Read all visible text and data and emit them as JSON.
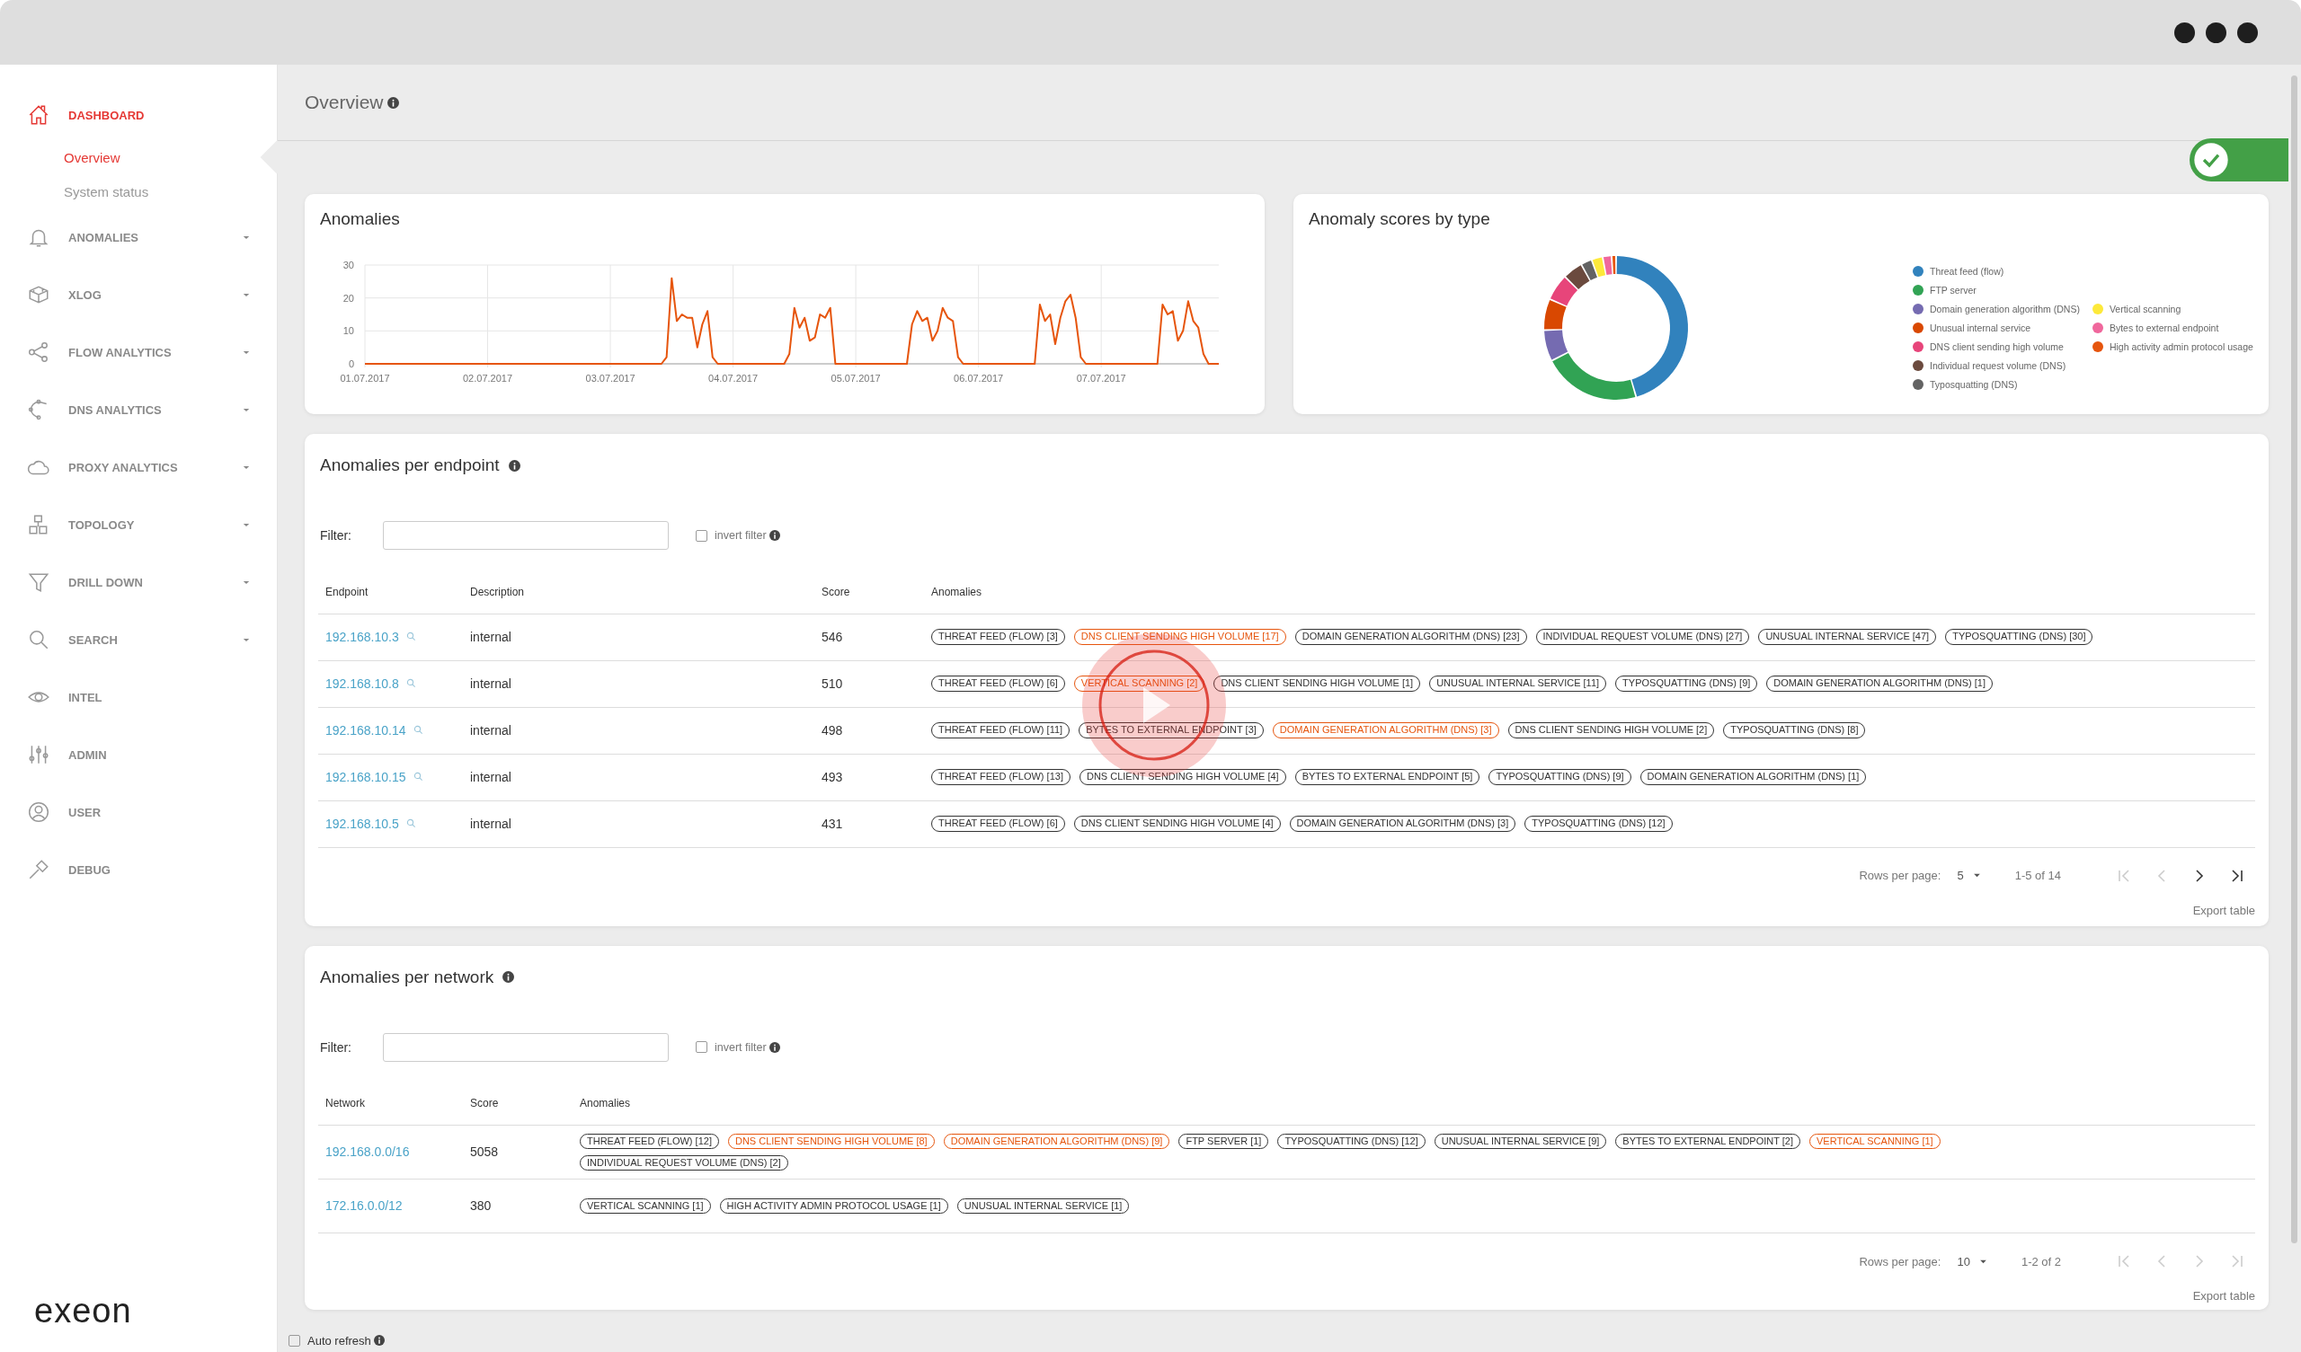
{
  "sidebar": {
    "items": [
      {
        "label": "DASHBOARD",
        "selected": true,
        "expandable": false,
        "children": [
          {
            "label": "Overview",
            "selected": true
          },
          {
            "label": "System status",
            "selected": false
          }
        ]
      },
      {
        "label": "ANOMALIES",
        "selected": false,
        "expandable": true
      },
      {
        "label": "XLOG",
        "selected": false,
        "expandable": true
      },
      {
        "label": "FLOW ANALYTICS",
        "selected": false,
        "expandable": true
      },
      {
        "label": "DNS ANALYTICS",
        "selected": false,
        "expandable": true
      },
      {
        "label": "PROXY ANALYTICS",
        "selected": false,
        "expandable": true
      },
      {
        "label": "TOPOLOGY",
        "selected": false,
        "expandable": true
      },
      {
        "label": "DRILL DOWN",
        "selected": false,
        "expandable": true
      },
      {
        "label": "SEARCH",
        "selected": false,
        "expandable": true
      },
      {
        "label": "INTEL",
        "selected": false,
        "expandable": false
      },
      {
        "label": "ADMIN",
        "selected": false,
        "expandable": false
      },
      {
        "label": "USER",
        "selected": false,
        "expandable": false
      },
      {
        "label": "DEBUG",
        "selected": false,
        "expandable": false
      }
    ]
  },
  "logo": "exeon",
  "page": {
    "title": "Overview"
  },
  "status_toggle": {
    "on": true
  },
  "anomalies_chart": {
    "title": "Anomalies",
    "chart_data": {
      "type": "line",
      "ylim": [
        0,
        30
      ],
      "yticks": [
        0,
        10,
        20,
        30
      ],
      "categories": [
        "01.07.2017",
        null,
        null,
        null,
        null,
        null,
        null,
        null,
        null,
        null,
        null,
        null,
        null,
        null,
        null,
        null,
        null,
        null,
        null,
        null,
        null,
        null,
        null,
        null,
        "02.07.2017",
        null,
        null,
        null,
        null,
        null,
        null,
        null,
        null,
        null,
        null,
        null,
        null,
        null,
        null,
        null,
        null,
        null,
        null,
        null,
        null,
        null,
        null,
        null,
        "03.07.2017",
        null,
        null,
        null,
        null,
        null,
        null,
        null,
        null,
        null,
        null,
        null,
        null,
        null,
        null,
        null,
        null,
        null,
        null,
        null,
        null,
        null,
        null,
        null,
        "04.07.2017",
        null,
        null,
        null,
        null,
        null,
        null,
        null,
        null,
        null,
        null,
        null,
        null,
        null,
        null,
        null,
        null,
        null,
        null,
        null,
        null,
        null,
        null,
        null,
        "05.07.2017",
        null,
        null,
        null,
        null,
        null,
        null,
        null,
        null,
        null,
        null,
        null,
        null,
        null,
        null,
        null,
        null,
        null,
        null,
        null,
        null,
        null,
        null,
        null,
        "06.07.2017",
        null,
        null,
        null,
        null,
        null,
        null,
        null,
        null,
        null,
        null,
        null,
        null,
        null,
        null,
        null,
        null,
        null,
        null,
        null,
        null,
        null,
        null,
        null,
        "07.07.2017",
        null,
        null,
        null,
        null,
        null,
        null,
        null,
        null,
        null,
        null,
        null,
        null,
        null,
        null,
        null,
        null,
        null,
        null,
        null,
        null,
        null,
        null,
        null
      ],
      "series": [
        {
          "color": "#e6550d",
          "values": [
            0,
            0,
            0,
            0,
            0,
            0,
            0,
            0,
            0,
            0,
            0,
            0,
            0,
            0,
            0,
            0,
            0,
            0,
            0,
            0,
            0,
            0,
            0,
            0,
            0,
            0,
            0,
            0,
            0,
            0,
            0,
            0,
            0,
            0,
            0,
            0,
            0,
            0,
            0,
            0,
            0,
            0,
            0,
            0,
            0,
            0,
            0,
            0,
            0,
            0,
            0,
            0,
            0,
            0,
            0,
            0,
            0,
            0,
            0,
            2,
            26,
            13,
            15,
            14,
            14,
            5,
            12,
            16,
            2,
            0,
            0,
            0,
            0,
            0,
            0,
            0,
            0,
            0,
            0,
            0,
            0,
            0,
            0,
            3,
            17,
            11,
            14,
            7,
            8,
            15,
            14,
            17,
            0,
            0,
            0,
            0,
            0,
            0,
            0,
            0,
            0,
            0,
            0,
            0,
            0,
            0,
            0,
            12,
            16,
            13,
            14,
            7,
            10,
            17,
            14,
            13,
            2,
            0,
            0,
            0,
            0,
            0,
            0,
            0,
            0,
            0,
            0,
            0,
            0,
            0,
            0,
            0,
            18,
            13,
            15,
            6,
            14,
            19,
            21,
            14,
            2,
            0,
            0,
            0,
            0,
            0,
            0,
            0,
            0,
            0,
            0,
            0,
            0,
            0,
            0,
            0,
            18,
            15,
            16,
            7,
            10,
            19,
            13,
            11,
            3,
            0,
            0,
            0
          ]
        }
      ]
    }
  },
  "scores_by_type": {
    "title": "Anomaly scores by type",
    "legend_column_1": [
      {
        "label": "Threat feed (flow)",
        "color": "#3182bd"
      },
      {
        "label": "FTP server",
        "color": "#31a354"
      },
      {
        "label": "Domain generation algorithm (DNS)",
        "color": "#756bb1"
      },
      {
        "label": "Unusual internal service",
        "color": "#d94801"
      },
      {
        "label": "DNS client sending high volume",
        "color": "#e7457a"
      },
      {
        "label": "Individual request volume (DNS)",
        "color": "#6b4a3e"
      },
      {
        "label": "Typosquatting (DNS)",
        "color": "#636363"
      }
    ],
    "legend_column_2": [
      {
        "label": "Vertical scanning",
        "color": "#fde93a"
      },
      {
        "label": "Bytes to external endpoint",
        "color": "#f0679c"
      },
      {
        "label": "High activity admin protocol usage",
        "color": "#e6550d"
      }
    ]
  },
  "endpoint_table": {
    "title": "Anomalies per endpoint",
    "filter_label": "Filter:",
    "invert_filter": {
      "label": "invert filter",
      "checked": false
    },
    "columns": [
      "Endpoint",
      "Description",
      "Score",
      "Anomalies"
    ],
    "rows": [
      {
        "endpoint": "192.168.10.3",
        "description": "internal",
        "score": "546",
        "anomalies": [
          {
            "label": "THREAT FEED (FLOW) [3]",
            "highlighted": false
          },
          {
            "label": "DNS CLIENT SENDING HIGH VOLUME [17]",
            "highlighted": true
          },
          {
            "label": "DOMAIN GENERATION ALGORITHM (DNS) [23]",
            "highlighted": false
          },
          {
            "label": "INDIVIDUAL REQUEST VOLUME (DNS) [27]",
            "highlighted": false
          },
          {
            "label": "UNUSUAL INTERNAL SERVICE [47]",
            "highlighted": false
          },
          {
            "label": "TYPOSQUATTING (DNS) [30]",
            "highlighted": false
          }
        ]
      },
      {
        "endpoint": "192.168.10.8",
        "description": "internal",
        "score": "510",
        "anomalies": [
          {
            "label": "THREAT FEED (FLOW) [6]",
            "highlighted": false
          },
          {
            "label": "VERTICAL SCANNING [2]",
            "highlighted": true
          },
          {
            "label": "DNS CLIENT SENDING HIGH VOLUME [1]",
            "highlighted": false
          },
          {
            "label": "UNUSUAL INTERNAL SERVICE [11]",
            "highlighted": false
          },
          {
            "label": "TYPOSQUATTING (DNS) [9]",
            "highlighted": false
          },
          {
            "label": "DOMAIN GENERATION ALGORITHM (DNS) [1]",
            "highlighted": false
          }
        ]
      },
      {
        "endpoint": "192.168.10.14",
        "description": "internal",
        "score": "498",
        "anomalies": [
          {
            "label": "THREAT FEED (FLOW) [11]",
            "highlighted": false
          },
          {
            "label": "BYTES TO EXTERNAL ENDPOINT [3]",
            "highlighted": false
          },
          {
            "label": "DOMAIN GENERATION ALGORITHM (DNS) [3]",
            "highlighted": true
          },
          {
            "label": "DNS CLIENT SENDING HIGH VOLUME [2]",
            "highlighted": false
          },
          {
            "label": "TYPOSQUATTING (DNS) [8]",
            "highlighted": false
          }
        ]
      },
      {
        "endpoint": "192.168.10.15",
        "description": "internal",
        "score": "493",
        "anomalies": [
          {
            "label": "THREAT FEED (FLOW) [13]",
            "highlighted": false
          },
          {
            "label": "DNS CLIENT SENDING HIGH VOLUME [4]",
            "highlighted": false
          },
          {
            "label": "BYTES TO EXTERNAL ENDPOINT [5]",
            "highlighted": false
          },
          {
            "label": "TYPOSQUATTING (DNS) [9]",
            "highlighted": false
          },
          {
            "label": "DOMAIN GENERATION ALGORITHM (DNS) [1]",
            "highlighted": false
          }
        ]
      },
      {
        "endpoint": "192.168.10.5",
        "description": "internal",
        "score": "431",
        "anomalies": [
          {
            "label": "THREAT FEED (FLOW) [6]",
            "highlighted": false
          },
          {
            "label": "DNS CLIENT SENDING HIGH VOLUME [4]",
            "highlighted": false
          },
          {
            "label": "DOMAIN GENERATION ALGORITHM (DNS) [3]",
            "highlighted": false
          },
          {
            "label": "TYPOSQUATTING (DNS) [12]",
            "highlighted": false
          }
        ]
      }
    ],
    "pagination": {
      "rows_per_page_label": "Rows per page:",
      "rows_per_page": "5",
      "range": "1-5 of 14",
      "first_disabled": true,
      "prev_disabled": true,
      "next_disabled": false,
      "last_disabled": false
    },
    "export": "Export table"
  },
  "network_table": {
    "title": "Anomalies per network",
    "filter_label": "Filter:",
    "invert_filter": {
      "label": "invert filter",
      "checked": false
    },
    "columns": [
      "Network",
      "Score",
      "Anomalies"
    ],
    "rows": [
      {
        "network": "192.168.0.0/16",
        "score": "5058",
        "anomalies": [
          {
            "label": "THREAT FEED (FLOW) [12]",
            "highlighted": false
          },
          {
            "label": "DNS CLIENT SENDING HIGH VOLUME [8]",
            "highlighted": true
          },
          {
            "label": "DOMAIN GENERATION ALGORITHM (DNS) [9]",
            "highlighted": true
          },
          {
            "label": "FTP SERVER [1]",
            "highlighted": false
          },
          {
            "label": "TYPOSQUATTING (DNS) [12]",
            "highlighted": false
          },
          {
            "label": "UNUSUAL INTERNAL SERVICE [9]",
            "highlighted": false
          },
          {
            "label": "BYTES TO EXTERNAL ENDPOINT [2]",
            "highlighted": false
          },
          {
            "label": "VERTICAL SCANNING [1]",
            "highlighted": true
          },
          {
            "label": "INDIVIDUAL REQUEST VOLUME (DNS) [2]",
            "highlighted": false
          }
        ]
      },
      {
        "network": "172.16.0.0/12",
        "score": "380",
        "anomalies": [
          {
            "label": "VERTICAL SCANNING [1]",
            "highlighted": false
          },
          {
            "label": "HIGH ACTIVITY ADMIN PROTOCOL USAGE [1]",
            "highlighted": false
          },
          {
            "label": "UNUSUAL INTERNAL SERVICE [1]",
            "highlighted": false
          }
        ]
      }
    ],
    "pagination": {
      "rows_per_page_label": "Rows per page:",
      "rows_per_page": "10",
      "range": "1-2 of 2",
      "first_disabled": true,
      "prev_disabled": true,
      "next_disabled": true,
      "last_disabled": true
    },
    "export": "Export table"
  },
  "auto_refresh": {
    "label": "Auto refresh",
    "checked": false
  }
}
